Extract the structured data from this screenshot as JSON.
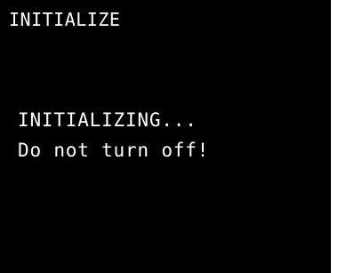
{
  "screen": {
    "title": "INITIALIZE",
    "status_line": "INITIALIZING...",
    "warning_line": "Do not turn off!"
  },
  "colors": {
    "background": "#000000",
    "text": "#ffffff"
  }
}
